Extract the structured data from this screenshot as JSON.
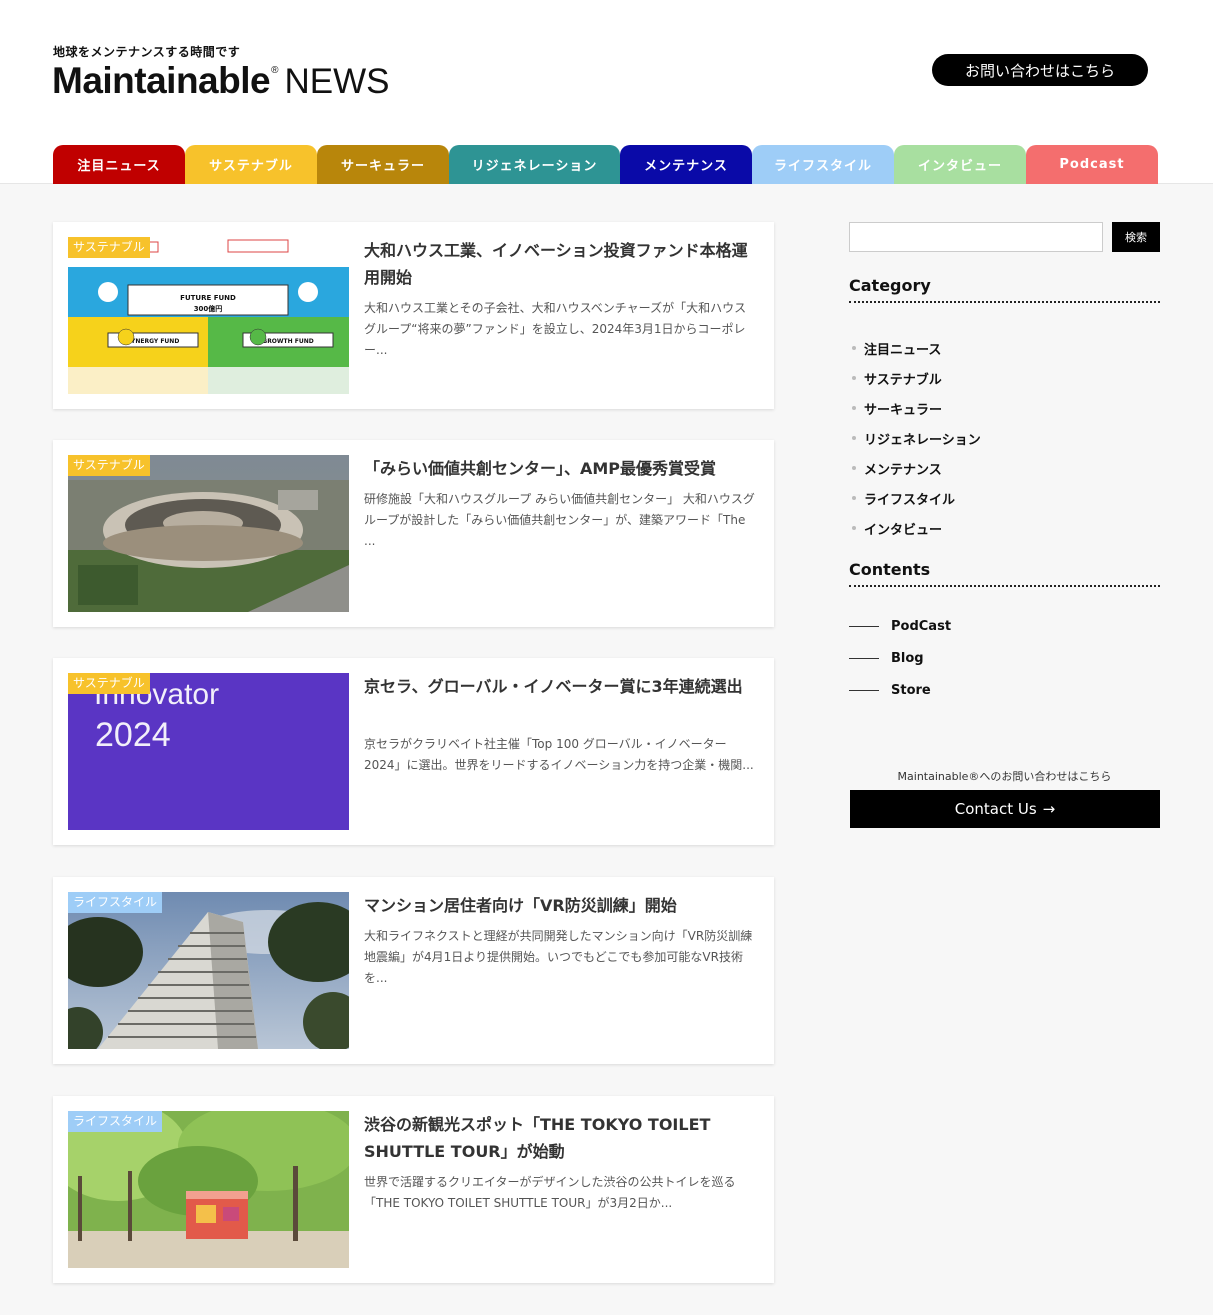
{
  "header": {
    "tagline": "地球をメンテナンスする時間です",
    "logo_main": "Maintainable",
    "logo_reg": "®",
    "logo_news": "NEWS",
    "contact_label": "お問い合わせはこちら"
  },
  "nav": [
    {
      "label": "注目ニュース",
      "color": "#c00000"
    },
    {
      "label": "サステナブル",
      "color": "#f7c22b"
    },
    {
      "label": "サーキュラー",
      "color": "#b8860b"
    },
    {
      "label": "リジェネレーション",
      "color": "#2e9494"
    },
    {
      "label": "メンテナンス",
      "color": "#0a0aa8"
    },
    {
      "label": "ライフスタイル",
      "color": "#9ecdf7"
    },
    {
      "label": "インタビュー",
      "color": "#a8dfa0"
    },
    {
      "label": "Podcast",
      "color": "#f46e6e"
    }
  ],
  "articles": [
    {
      "category": "サステナブル",
      "category_color": "#f7c22b",
      "title": "大和ハウス工業、イノベーション投資ファンド本格運用開始",
      "excerpt": "大和ハウス工業とその子会社、大和ハウスベンチャーズが「大和ハウスグループ“将来の夢”ファンド」を設立し、2024年3月1日からコーポレー...",
      "image": {
        "fund_main": "FUTURE FUND",
        "fund_amount": "300億円",
        "fund_left": "SYNERGY FUND",
        "fund_right": "GROWTH FUND"
      }
    },
    {
      "category": "サステナブル",
      "category_color": "#f7c22b",
      "title": "「みらい価値共創センター」、AMP最優秀賞受賞",
      "excerpt": "研修施設「大和ハウスグループ みらい価値共創センター」 大和ハウスグループが設計した「みらい価値共創センター」が、建築アワード「The ..."
    },
    {
      "category": "サステナブル",
      "category_color": "#f7c22b",
      "title": "京セラ、グローバル・イノベーター賞に3年連続選出",
      "excerpt": "京セラがクラリベイト社主催「Top 100 グローバル・イノベーター 2024」に選出。世界をリードするイノベーション力を持つ企業・機関...",
      "image": {
        "line1": "Innovator",
        "line2": "2024"
      }
    },
    {
      "category": "ライフスタイル",
      "category_color": "#9ecdf7",
      "title": "マンション居住者向け「VR防災訓練」開始",
      "excerpt": "大和ライフネクストと理経が共同開発したマンション向け「VR防災訓練 地震編」が4月1日より提供開始。いつでもどこでも参加可能なVR技術を..."
    },
    {
      "category": "ライフスタイル",
      "category_color": "#9ecdf7",
      "title": "渋谷の新観光スポット「THE TOKYO TOILET SHUTTLE TOUR」が始動",
      "excerpt": "世界で活躍するクリエイターがデザインした渋谷の公共トイレを巡る「THE TOKYO TOILET SHUTTLE TOUR」が3月2日か..."
    }
  ],
  "sidebar": {
    "search_button": "検索",
    "category_title": "Category",
    "categories": [
      "注目ニュース",
      "サステナブル",
      "サーキュラー",
      "リジェネレーション",
      "メンテナンス",
      "ライフスタイル",
      "インタビュー"
    ],
    "contents_title": "Contents",
    "contents": [
      "PodCast",
      "Blog",
      "Store"
    ],
    "contact_note": "Maintainable®へのお問い合わせはこちら",
    "contact_button": "Contact Us",
    "contact_arrow": "→"
  }
}
